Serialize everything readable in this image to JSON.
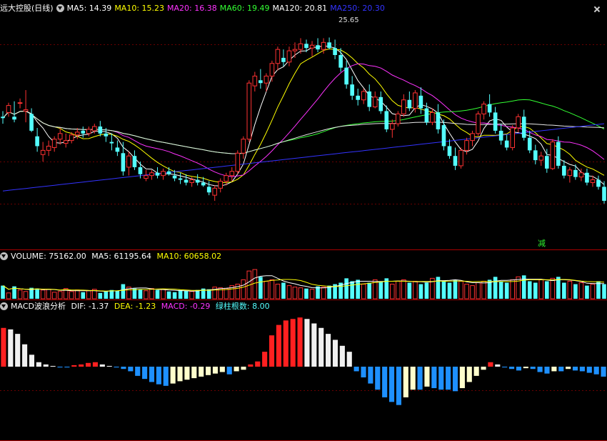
{
  "main": {
    "title": "远大控股(日线)",
    "ma": [
      {
        "label": "MA5: 14.39",
        "color": "#ffffff"
      },
      {
        "label": "MA10: 15.23",
        "color": "#ffff00"
      },
      {
        "label": "MA20: 16.38",
        "color": "#ff33ff"
      },
      {
        "label": "MA60: 19.49",
        "color": "#33ff33"
      },
      {
        "label": "MA120: 20.81",
        "color": "#ffffff"
      },
      {
        "label": "MA250: 20.30",
        "color": "#3333ff"
      }
    ],
    "peak_label": "25.65",
    "signal_badge": "减"
  },
  "volume": {
    "label": "VOLUME: 75162.00",
    "ma5": "MA5: 61195.64",
    "ma10": "MA10: 60658.02"
  },
  "macd": {
    "title": "MACD波浪分析",
    "dif": "DIF: -1.37",
    "dea": "DEA: -1.23",
    "macd": "MACD: -0.29",
    "green_count": "绿柱根数: 8.00"
  },
  "chart_data": {
    "type": "candlestick",
    "up_color": "#ff3232",
    "down_color": "#54ffff",
    "price_range": [
      11.5,
      27.0
    ],
    "ohlc": [
      [
        20.0,
        20.4,
        19.5,
        19.9
      ],
      [
        20.3,
        21.0,
        20.0,
        20.8
      ],
      [
        20.0,
        21.1,
        19.6,
        19.8
      ],
      [
        21.0,
        21.3,
        20.6,
        21.0
      ],
      [
        20.4,
        21.9,
        19.6,
        20.5
      ],
      [
        20.2,
        20.6,
        18.9,
        19.0
      ],
      [
        18.6,
        19.2,
        17.5,
        17.9
      ],
      [
        17.3,
        18.2,
        16.8,
        17.6
      ],
      [
        17.6,
        18.3,
        17.2,
        17.9
      ],
      [
        17.8,
        18.6,
        17.5,
        18.4
      ],
      [
        18.4,
        19.2,
        18.0,
        18.8
      ],
      [
        18.1,
        18.8,
        17.8,
        18.3
      ],
      [
        18.3,
        18.9,
        18.1,
        18.7
      ],
      [
        18.7,
        19.2,
        18.4,
        18.9
      ],
      [
        19.0,
        19.3,
        18.5,
        18.8
      ],
      [
        18.8,
        19.3,
        18.6,
        19.1
      ],
      [
        19.0,
        19.5,
        18.8,
        19.3
      ],
      [
        19.3,
        19.7,
        18.6,
        18.8
      ],
      [
        18.8,
        19.2,
        18.2,
        18.6
      ],
      [
        18.2,
        18.8,
        17.6,
        18.1
      ],
      [
        17.8,
        18.3,
        17.2,
        17.5
      ],
      [
        17.4,
        18.2,
        15.8,
        16.1
      ],
      [
        16.4,
        17.5,
        15.8,
        17.2
      ],
      [
        17.2,
        17.6,
        16.2,
        16.4
      ],
      [
        16.4,
        16.8,
        15.6,
        15.9
      ],
      [
        15.6,
        16.2,
        15.4,
        15.8
      ],
      [
        15.8,
        16.2,
        15.5,
        16.0
      ],
      [
        16.0,
        16.4,
        15.6,
        15.8
      ],
      [
        15.8,
        16.3,
        15.5,
        16.1
      ],
      [
        16.1,
        16.4,
        15.8,
        15.9
      ],
      [
        15.8,
        16.2,
        15.4,
        15.6
      ],
      [
        15.6,
        16.0,
        15.2,
        15.5
      ],
      [
        15.5,
        15.9,
        15.1,
        15.3
      ],
      [
        15.3,
        15.7,
        15.0,
        15.5
      ],
      [
        15.5,
        15.9,
        15.1,
        15.3
      ],
      [
        15.3,
        15.7,
        15.0,
        15.1
      ],
      [
        15.0,
        15.4,
        14.4,
        14.6
      ],
      [
        14.4,
        15.1,
        14.0,
        14.9
      ],
      [
        14.9,
        15.6,
        14.6,
        15.4
      ],
      [
        15.4,
        16.0,
        15.1,
        15.8
      ],
      [
        15.8,
        16.4,
        15.4,
        16.1
      ],
      [
        16.1,
        17.6,
        15.9,
        17.4
      ],
      [
        17.4,
        18.6,
        17.0,
        18.4
      ],
      [
        18.4,
        22.6,
        18.2,
        22.4
      ],
      [
        22.2,
        23.2,
        21.8,
        22.9
      ],
      [
        22.6,
        23.4,
        22.0,
        22.4
      ],
      [
        22.4,
        23.1,
        21.8,
        22.9
      ],
      [
        22.9,
        24.0,
        22.5,
        23.8
      ],
      [
        23.8,
        25.0,
        23.3,
        24.8
      ],
      [
        24.2,
        24.8,
        23.6,
        23.9
      ],
      [
        23.9,
        25.0,
        23.6,
        24.7
      ],
      [
        24.7,
        25.3,
        24.2,
        24.8
      ],
      [
        24.8,
        25.6,
        24.5,
        25.2
      ],
      [
        25.2,
        25.5,
        24.6,
        24.9
      ],
      [
        24.9,
        25.4,
        24.3,
        25.1
      ],
      [
        25.1,
        25.6,
        24.6,
        24.8
      ],
      [
        24.8,
        25.6,
        24.5,
        25.3
      ],
      [
        25.3,
        25.65,
        24.8,
        24.9
      ],
      [
        24.9,
        25.5,
        24.1,
        24.4
      ],
      [
        24.4,
        24.9,
        23.2,
        23.5
      ],
      [
        23.5,
        24.0,
        22.0,
        22.3
      ],
      [
        22.3,
        22.9,
        21.2,
        21.5
      ],
      [
        21.5,
        22.0,
        20.8,
        21.2
      ],
      [
        21.2,
        22.0,
        20.9,
        21.8
      ],
      [
        21.8,
        22.3,
        20.4,
        20.7
      ],
      [
        20.7,
        21.8,
        20.6,
        21.4
      ],
      [
        21.4,
        21.8,
        20.2,
        20.4
      ],
      [
        20.4,
        20.8,
        18.9,
        19.1
      ],
      [
        19.1,
        19.8,
        18.5,
        19.5
      ],
      [
        19.5,
        20.4,
        19.3,
        20.2
      ],
      [
        20.2,
        21.6,
        20.0,
        21.2
      ],
      [
        21.2,
        21.8,
        20.4,
        20.6
      ],
      [
        20.6,
        21.9,
        20.3,
        21.7
      ],
      [
        21.5,
        22.1,
        20.2,
        20.6
      ],
      [
        20.6,
        21.0,
        19.4,
        19.6
      ],
      [
        19.6,
        20.6,
        19.4,
        20.3
      ],
      [
        20.3,
        20.9,
        18.8,
        19.1
      ],
      [
        19.4,
        19.8,
        17.6,
        17.9
      ],
      [
        17.9,
        18.4,
        17.0,
        17.2
      ],
      [
        17.2,
        17.8,
        16.2,
        16.5
      ],
      [
        16.5,
        17.8,
        16.3,
        17.6
      ],
      [
        17.6,
        18.5,
        17.3,
        18.3
      ],
      [
        18.3,
        19.0,
        17.9,
        18.8
      ],
      [
        18.8,
        20.4,
        18.6,
        20.2
      ],
      [
        20.2,
        21.1,
        19.8,
        20.9
      ],
      [
        20.9,
        21.6,
        20.0,
        20.3
      ],
      [
        20.3,
        20.7,
        18.8,
        19.0
      ],
      [
        19.0,
        19.5,
        18.0,
        18.3
      ],
      [
        18.3,
        18.7,
        17.6,
        17.8
      ],
      [
        17.8,
        19.4,
        17.6,
        19.2
      ],
      [
        19.2,
        20.2,
        18.9,
        20.0
      ],
      [
        20.0,
        20.5,
        18.3,
        18.5
      ],
      [
        18.5,
        19.0,
        17.4,
        17.6
      ],
      [
        17.6,
        18.0,
        16.6,
        16.9
      ],
      [
        16.9,
        17.5,
        16.5,
        17.2
      ],
      [
        17.2,
        17.7,
        16.0,
        16.3
      ],
      [
        16.3,
        18.4,
        16.2,
        18.2
      ],
      [
        18.2,
        18.6,
        16.3,
        16.5
      ],
      [
        16.5,
        16.9,
        15.6,
        15.8
      ],
      [
        15.8,
        16.4,
        15.3,
        16.2
      ],
      [
        16.2,
        16.6,
        15.5,
        15.7
      ],
      [
        15.7,
        16.3,
        15.4,
        16.0
      ],
      [
        16.0,
        16.3,
        15.1,
        15.3
      ],
      [
        15.3,
        15.8,
        15.0,
        15.5
      ],
      [
        15.5,
        15.8,
        14.8,
        15.0
      ],
      [
        15.0,
        15.4,
        13.8,
        14.0
      ]
    ],
    "volume_values": [
      18,
      8,
      17,
      12,
      10,
      15,
      14,
      12,
      13,
      9,
      10,
      14,
      10,
      12,
      9,
      11,
      13,
      8,
      10,
      12,
      11,
      20,
      16,
      14,
      13,
      11,
      14,
      12,
      13,
      10,
      9,
      12,
      11,
      10,
      12,
      14,
      13,
      16,
      15,
      14,
      18,
      20,
      26,
      38,
      40,
      30,
      24,
      26,
      20,
      22,
      18,
      16,
      15,
      14,
      13,
      17,
      16,
      18,
      20,
      22,
      28,
      24,
      26,
      20,
      22,
      26,
      24,
      28,
      20,
      24,
      26,
      22,
      24,
      20,
      22,
      28,
      30,
      24,
      22,
      26,
      24,
      20,
      18,
      22,
      24,
      26,
      30,
      24,
      22,
      26,
      30,
      32,
      24,
      22,
      26,
      24,
      28,
      30,
      22,
      24,
      20,
      22,
      18,
      20,
      24,
      20
    ],
    "volume_range": [
      0,
      45
    ],
    "macd_values": [
      0.52,
      0.5,
      0.44,
      0.3,
      0.16,
      0.06,
      0.03,
      0.01,
      -0.01,
      -0.01,
      0.02,
      0.03,
      0.05,
      0.06,
      0.03,
      0.01,
      -0.01,
      -0.03,
      -0.06,
      -0.12,
      -0.16,
      -0.2,
      -0.23,
      -0.25,
      -0.22,
      -0.19,
      -0.17,
      -0.15,
      -0.13,
      -0.11,
      -0.09,
      -0.07,
      -0.1,
      -0.06,
      -0.04,
      0.03,
      0.07,
      0.2,
      0.42,
      0.56,
      0.62,
      0.64,
      0.66,
      0.64,
      0.58,
      0.52,
      0.44,
      0.36,
      0.28,
      0.2,
      -0.06,
      -0.14,
      -0.22,
      -0.3,
      -0.4,
      -0.46,
      -0.5,
      -0.4,
      -0.3,
      -0.3,
      -0.26,
      -0.28,
      -0.3,
      -0.3,
      -0.32,
      -0.28,
      -0.2,
      -0.12,
      -0.04,
      0.06,
      0.03,
      -0.01,
      -0.03,
      -0.05,
      -0.02,
      -0.03,
      -0.07,
      -0.09,
      -0.06,
      -0.06,
      -0.03,
      -0.05,
      -0.06,
      -0.08,
      -0.1,
      -0.13
    ],
    "macd_range": [
      -0.55,
      0.7
    ]
  }
}
